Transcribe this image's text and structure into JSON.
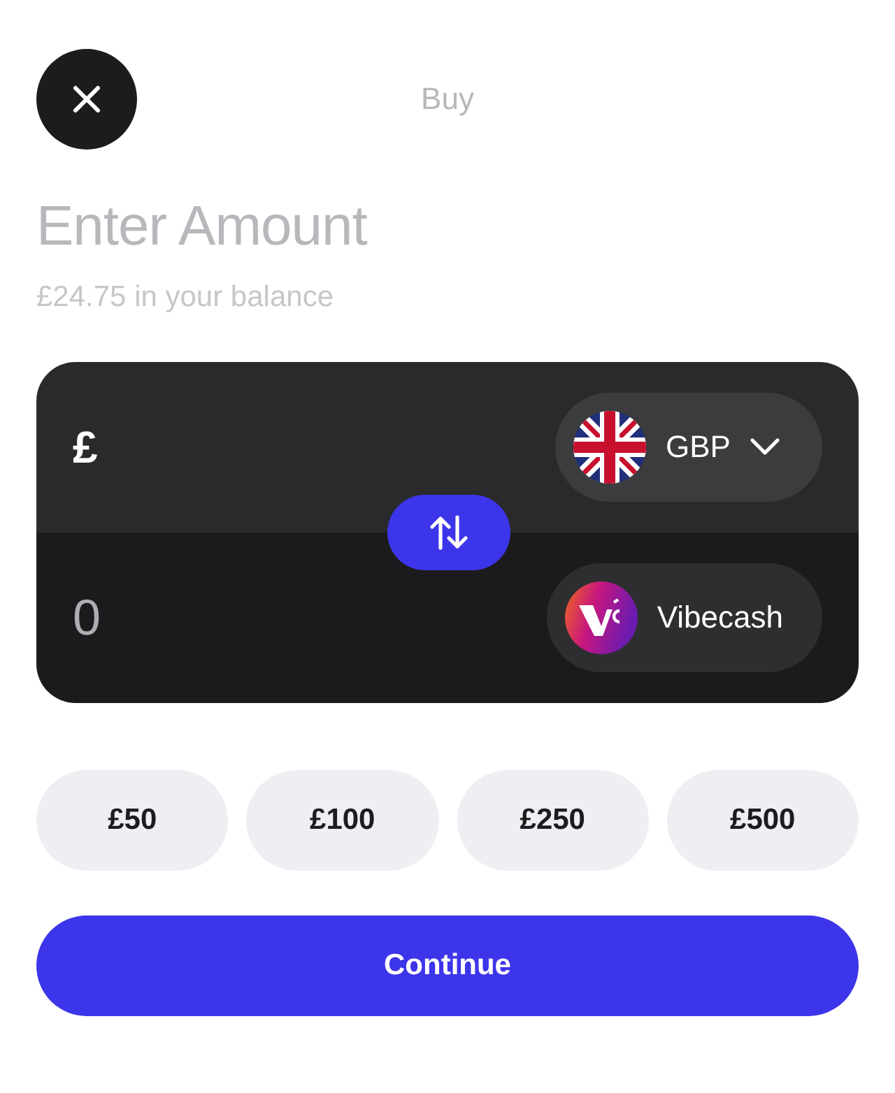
{
  "header": {
    "title": "Buy"
  },
  "heading": "Enter Amount",
  "balance": "£24.75 in your balance",
  "exchange": {
    "from": {
      "symbol": "£",
      "currency": "GBP",
      "has_dropdown": true
    },
    "to": {
      "amount": "0",
      "currency": "Vibecash",
      "has_dropdown": false
    }
  },
  "presets": [
    "£50",
    "£100",
    "£250",
    "£500"
  ],
  "continue_button": "Continue"
}
